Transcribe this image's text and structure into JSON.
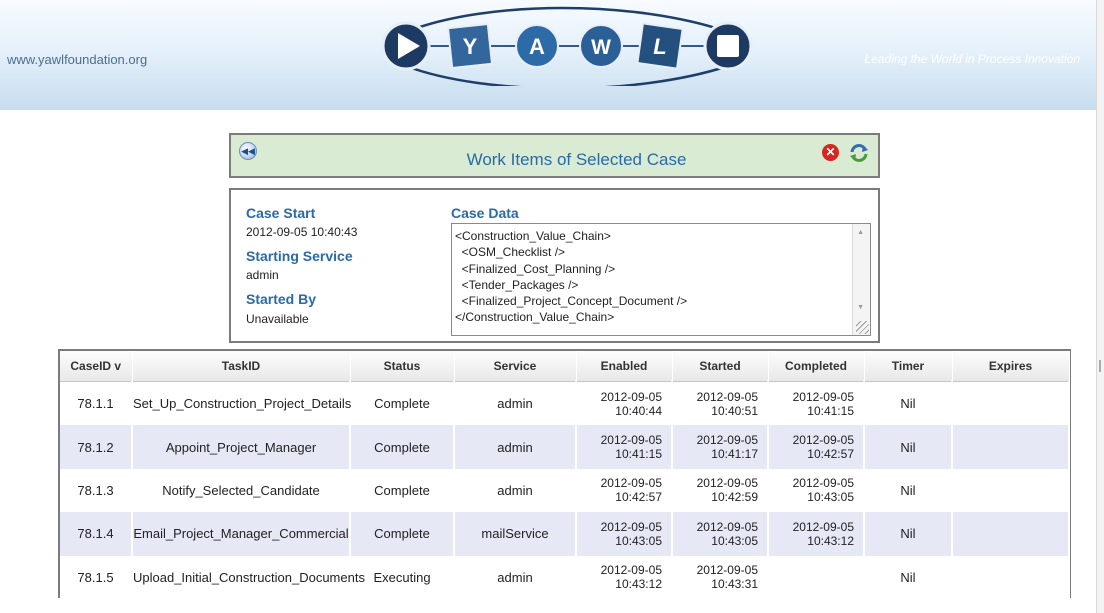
{
  "header": {
    "site_url": "www.yawlfoundation.org",
    "tagline": "Leading the World in Process Innovation",
    "logo_letters": [
      "Y",
      "A",
      "W",
      "L"
    ]
  },
  "panel": {
    "title": "Work Items of Selected Case",
    "icons": {
      "back": "rewind-icon",
      "close": "close-icon",
      "refresh": "refresh-icon"
    }
  },
  "case_info": {
    "case_start_label": "Case Start",
    "case_start_value": "2012-09-05 10:40:43",
    "starting_service_label": "Starting Service",
    "starting_service_value": "admin",
    "started_by_label": "Started By",
    "started_by_value": "Unavailable",
    "case_data_label": "Case Data",
    "case_data_lines": [
      "<Construction_Value_Chain>",
      "  <OSM_Checklist />",
      "  <Finalized_Cost_Planning />",
      "  <Tender_Packages />",
      "  <Finalized_Project_Concept_Document />",
      "</Construction_Value_Chain>"
    ]
  },
  "table": {
    "columns": [
      "CaseID v",
      "TaskID",
      "Status",
      "Service",
      "Enabled",
      "Started",
      "Completed",
      "Timer",
      "Expires"
    ],
    "rows": [
      {
        "case_id": "78.1.1",
        "task_id": "Set_Up_Construction_Project_Details",
        "status": "Complete",
        "service": "admin",
        "enabled_date": "2012-09-05",
        "enabled_time": "10:40:44",
        "started_date": "2012-09-05",
        "started_time": "10:40:51",
        "completed_date": "2012-09-05",
        "completed_time": "10:41:15",
        "timer": "Nil",
        "expires": ""
      },
      {
        "case_id": "78.1.2",
        "task_id": "Appoint_Project_Manager",
        "status": "Complete",
        "service": "admin",
        "enabled_date": "2012-09-05",
        "enabled_time": "10:41:15",
        "started_date": "2012-09-05",
        "started_time": "10:41:17",
        "completed_date": "2012-09-05",
        "completed_time": "10:42:57",
        "timer": "Nil",
        "expires": ""
      },
      {
        "case_id": "78.1.3",
        "task_id": "Notify_Selected_Candidate",
        "status": "Complete",
        "service": "admin",
        "enabled_date": "2012-09-05",
        "enabled_time": "10:42:57",
        "started_date": "2012-09-05",
        "started_time": "10:42:59",
        "completed_date": "2012-09-05",
        "completed_time": "10:43:05",
        "timer": "Nil",
        "expires": ""
      },
      {
        "case_id": "78.1.4",
        "task_id": "Email_Project_Manager_Commercial",
        "status": "Complete",
        "service": "mailService",
        "enabled_date": "2012-09-05",
        "enabled_time": "10:43:05",
        "started_date": "2012-09-05",
        "started_time": "10:43:05",
        "completed_date": "2012-09-05",
        "completed_time": "10:43:12",
        "timer": "Nil",
        "expires": ""
      },
      {
        "case_id": "78.1.5",
        "task_id": "Upload_Initial_Construction_Documents",
        "status": "Executing",
        "service": "admin",
        "enabled_date": "2012-09-05",
        "enabled_time": "10:43:12",
        "started_date": "2012-09-05",
        "started_time": "10:43:31",
        "completed_date": "",
        "completed_time": "",
        "timer": "Nil",
        "expires": ""
      }
    ]
  },
  "colors": {
    "accent": "#2a6aa6",
    "title_bg": "#d9ebd3",
    "row_alt": "#e6e8f6",
    "close_red": "#d9241f"
  }
}
